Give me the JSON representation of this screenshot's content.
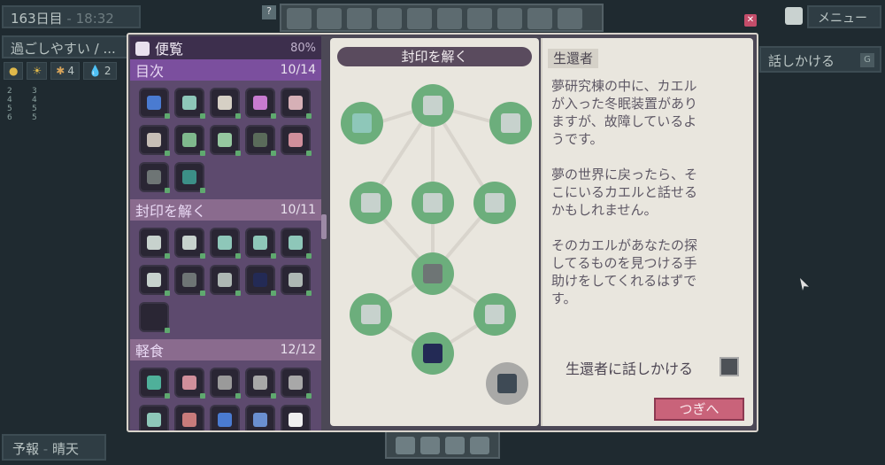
{
  "hud": {
    "day": "163日目",
    "sep": "-",
    "time": "18:32",
    "status": "過ごしやすい / ...",
    "stats": [
      {
        "icon": "coin-icon",
        "value": ""
      },
      {
        "icon": "sun-icon",
        "value": ""
      },
      {
        "icon": "star-icon",
        "value": "4"
      },
      {
        "icon": "drop-icon",
        "value": "2"
      }
    ],
    "inventory": [
      "2",
      "3",
      "4",
      "4",
      "5",
      "5",
      "6",
      "5"
    ],
    "menu": "メニュー",
    "talk_label": "話しかける",
    "talk_key": "G",
    "forecast_label": "予報",
    "forecast_value": "晴天",
    "help": "?"
  },
  "window": {
    "title": "便覧",
    "percent": "80%",
    "sections": [
      {
        "label": "目次",
        "count": "10/14",
        "slots": 12,
        "colors": [
          "#4a7bd1",
          "#8ec7b9",
          "#d6d0c5",
          "#c87bd0",
          "#d6b0b6",
          "#c7beb6",
          "#7fb98d",
          "#96c8a0",
          "#5a6b5a",
          "#d08f9b",
          "#6e7575",
          "#3c8f87"
        ]
      },
      {
        "label": "封印を解く",
        "count": "10/11",
        "slots": 11,
        "colors": [
          "#c7d2cd",
          "#c7d2cd",
          "#8ec7b9",
          "#8ec7b9",
          "#8ec7b9",
          "#c7d2cd",
          "#6e7575",
          "#aeb8b4",
          "#232a55",
          "#aeb8b4",
          "#2a2634"
        ]
      },
      {
        "label": "軽食",
        "count": "12/12",
        "slots": 10,
        "colors": [
          "#4fb09a",
          "#d08f9b",
          "#9a9a9a",
          "#a8a8a8",
          "#a8a8a8",
          "#8ec7b9",
          "#c87b7b",
          "#4a7bd1",
          "#6a8fd0",
          "#efefef"
        ]
      }
    ]
  },
  "map": {
    "title": "封印を解く",
    "nodes": [
      {
        "color": "#8ec7b9"
      },
      {
        "color": "#c7d2cd"
      },
      {
        "color": "#c7d2cd"
      },
      {
        "color": "#c7d2cd"
      },
      {
        "color": "#c7d2cd"
      },
      {
        "color": "#c7d2cd"
      },
      {
        "color": "#6e7575"
      },
      {
        "color": "#c7d2cd"
      },
      {
        "color": "#c7d2cd"
      },
      {
        "color": "#232a55"
      },
      {
        "color": "#3e4a55"
      }
    ]
  },
  "desc": {
    "tag": "生還者",
    "body": "夢研究棟の中に、カエル\nが入った冬眠装置があり\nますが、故障しているよ\nうです。\n\n夢の世界に戻ったら、そ\nこにいるカエルと話せる\nかもしれません。\n\nそのカエルがあなたの探\nしてるものを見つける手\n助けをしてくれるはずで\nす。",
    "talk": "生還者に話しかける",
    "next": "つぎへ"
  }
}
